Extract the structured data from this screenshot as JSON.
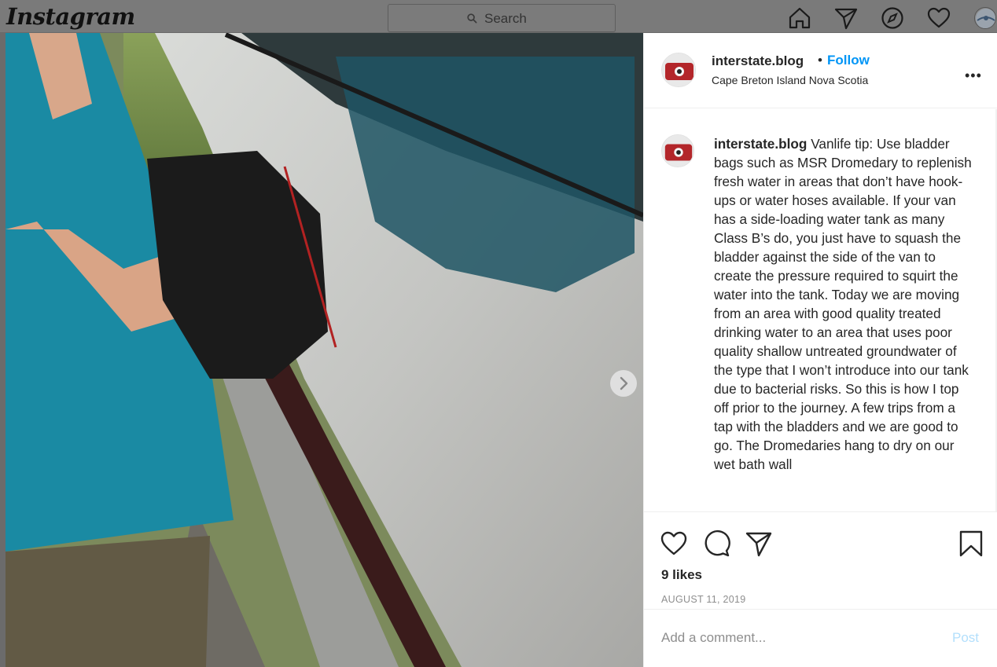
{
  "topbar": {
    "logo": "Instagram",
    "search_placeholder": "Search",
    "icons": [
      "home-icon",
      "direct-icon",
      "explore-icon",
      "activity-heart-icon",
      "profile-avatar"
    ]
  },
  "post": {
    "username": "interstate.blog",
    "separator": "•",
    "follow_label": "Follow",
    "location": "Cape Breton Island Nova Scotia",
    "more_label": "•••",
    "caption_user": "interstate.blog",
    "caption_text": " Vanlife tip: Use bladder bags such as MSR Dromedary to replenish fresh water in areas that don’t have hook-ups or water hoses available. If your van has a side-loading water tank as many Class B’s do, you just have to squash the bladder against the side of the van to create the pressure required to squirt the water into the tank. Today we are moving from an area with good quality treated drinking water to an area that uses poor quality shallow untreated groundwater of the type that I won’t introduce into our tank due to bacterial risks. So this is how I top off prior to the journey. A few trips from a tap with the bladders and we are good to go. The Dromedaries hang to dry on our wet bath wall",
    "likes": "9 likes",
    "date": "AUGUST 11, 2019",
    "comment_placeholder": "Add a comment...",
    "post_label": "Post",
    "carousel": {
      "count": 2,
      "active_index": 0
    }
  },
  "colors": {
    "accent_blue": "#0095f6",
    "post_disabled": "#b2dffc",
    "shirt_teal": "#1a8aa3"
  }
}
